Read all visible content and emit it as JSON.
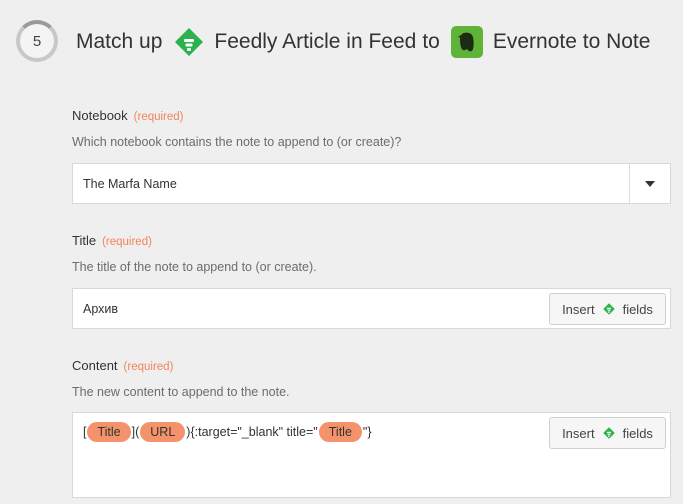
{
  "header": {
    "step_number": "5",
    "prefix": "Match up",
    "source_app": "Feedly Article in Feed",
    "connector": "to",
    "target_app": "Evernote to Note"
  },
  "fields": {
    "notebook": {
      "label": "Notebook",
      "required": "(required)",
      "help": "Which notebook contains the note to append to (or create)?",
      "value": "The Marfa Name"
    },
    "title": {
      "label": "Title",
      "required": "(required)",
      "help": "The title of the note to append to (or create).",
      "value": "Архив",
      "insert_label": "Insert",
      "fields_label": "fields"
    },
    "content": {
      "label": "Content",
      "required": "(required)",
      "help": "The new content to append to the note.",
      "insert_label": "Insert",
      "fields_label": "fields",
      "parts": {
        "open_bracket": "[",
        "token1": "Title",
        "mid1": "](",
        "token2": "URL",
        "mid2": "){:target=\"_blank\" title=\"",
        "token3": "Title",
        "end": "\"}"
      }
    }
  },
  "colors": {
    "feedly_green": "#2bb24c",
    "evernote_green": "#5fb336",
    "required_orange": "#f0855a",
    "token_bg": "#f4936b",
    "background": "#efefef"
  }
}
